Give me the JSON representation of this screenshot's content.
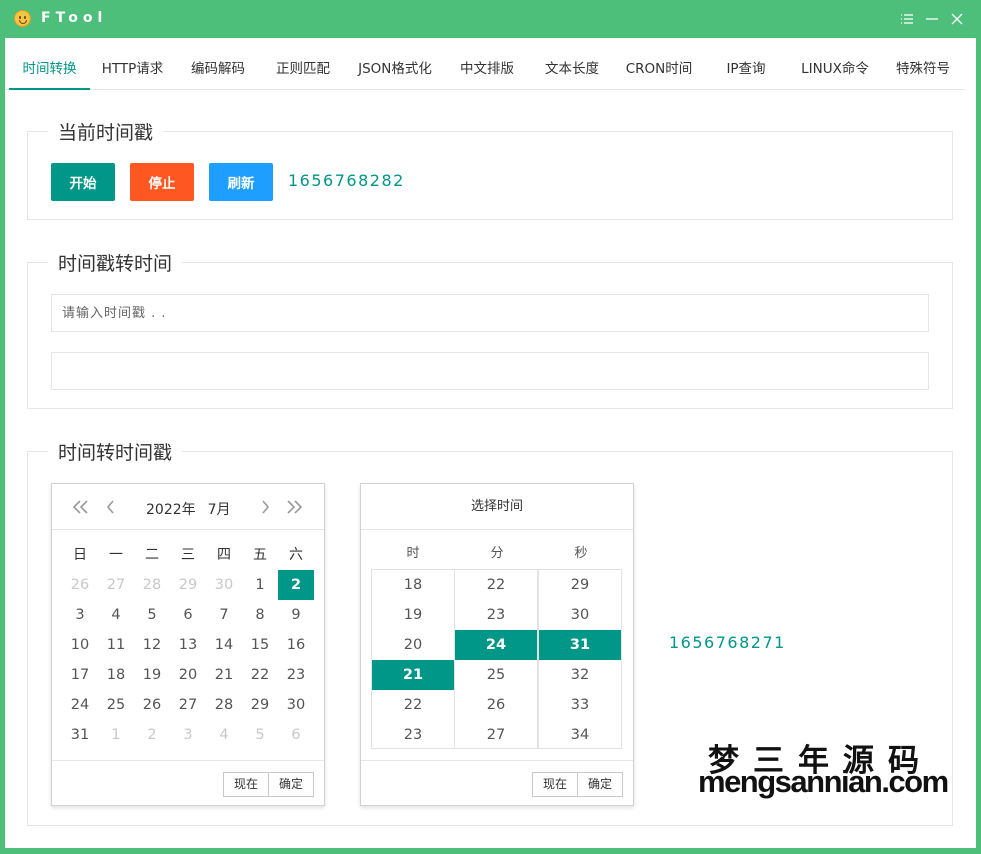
{
  "window": {
    "title": "FTool"
  },
  "tabs": [
    "时间转换",
    "HTTP请求",
    "编码解码",
    "正则匹配",
    "JSON格式化",
    "中文排版",
    "文本长度",
    "CRON时间",
    "IP查询",
    "LINUX命令",
    "特殊符号"
  ],
  "active_tab": 0,
  "section_current": {
    "legend": "当前时间戳",
    "buttons": {
      "start": "开始",
      "stop": "停止",
      "refresh": "刷新"
    },
    "timestamp": "1656768282",
    "colors": {
      "start": "#009688",
      "stop": "#ff5722",
      "refresh": "#1e9fff"
    }
  },
  "section_ts2time": {
    "legend": "时间戳转时间",
    "input_placeholder": "请输入时间戳 . .",
    "output_value": ""
  },
  "section_time2ts": {
    "legend": "时间转时间戳",
    "calendar": {
      "year": "2022年",
      "month": "7月",
      "weekdays": [
        "日",
        "一",
        "二",
        "三",
        "四",
        "五",
        "六"
      ],
      "days": [
        [
          "26",
          "27",
          "28",
          "29",
          "30",
          "1",
          "2"
        ],
        [
          "3",
          "4",
          "5",
          "6",
          "7",
          "8",
          "9"
        ],
        [
          "10",
          "11",
          "12",
          "13",
          "14",
          "15",
          "16"
        ],
        [
          "17",
          "18",
          "19",
          "20",
          "21",
          "22",
          "23"
        ],
        [
          "24",
          "25",
          "26",
          "27",
          "28",
          "29",
          "30"
        ],
        [
          "31",
          "1",
          "2",
          "3",
          "4",
          "5",
          "6"
        ]
      ],
      "selected_day": "2",
      "now_label": "现在",
      "confirm_label": "确定"
    },
    "time_picker": {
      "title": "选择时间",
      "columns": [
        "时",
        "分",
        "秒"
      ],
      "hours": [
        "18",
        "19",
        "20",
        "21",
        "22",
        "23"
      ],
      "minutes": [
        "22",
        "23",
        "24",
        "25",
        "26",
        "27"
      ],
      "seconds": [
        "29",
        "30",
        "31",
        "32",
        "33",
        "34"
      ],
      "selected": {
        "hour": "21",
        "minute": "24",
        "second": "31"
      },
      "now_label": "现在",
      "confirm_label": "确定"
    },
    "timestamp": "1656768271"
  },
  "watermark": {
    "cn": "梦三年源码",
    "en": "mengsannian.com"
  }
}
